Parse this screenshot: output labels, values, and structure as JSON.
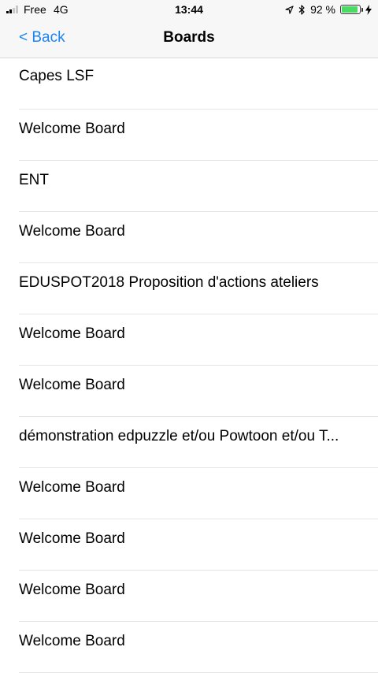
{
  "status_bar": {
    "carrier": "Free",
    "network": "4G",
    "time": "13:44",
    "battery_percent": "92 %",
    "battery_level": 0.92,
    "icons": [
      "signal-bars-icon",
      "location-arrow-icon",
      "bluetooth-icon",
      "battery-icon",
      "charging-bolt-icon"
    ],
    "battery_color": "#4cd964"
  },
  "nav": {
    "back_label": "< Back",
    "title": "Boards",
    "accent_color": "#1a84f5"
  },
  "boards": [
    {
      "name": "Capes LSF"
    },
    {
      "name": "Welcome Board"
    },
    {
      "name": "ENT"
    },
    {
      "name": "Welcome Board"
    },
    {
      "name": "EDUSPOT2018 Proposition d'actions ateliers"
    },
    {
      "name": "Welcome Board"
    },
    {
      "name": "Welcome Board"
    },
    {
      "name": "démonstration edpuzzle et/ou Powtoon et/ou T..."
    },
    {
      "name": "Welcome Board"
    },
    {
      "name": "Welcome Board"
    },
    {
      "name": "Welcome Board"
    },
    {
      "name": "Welcome Board"
    }
  ]
}
